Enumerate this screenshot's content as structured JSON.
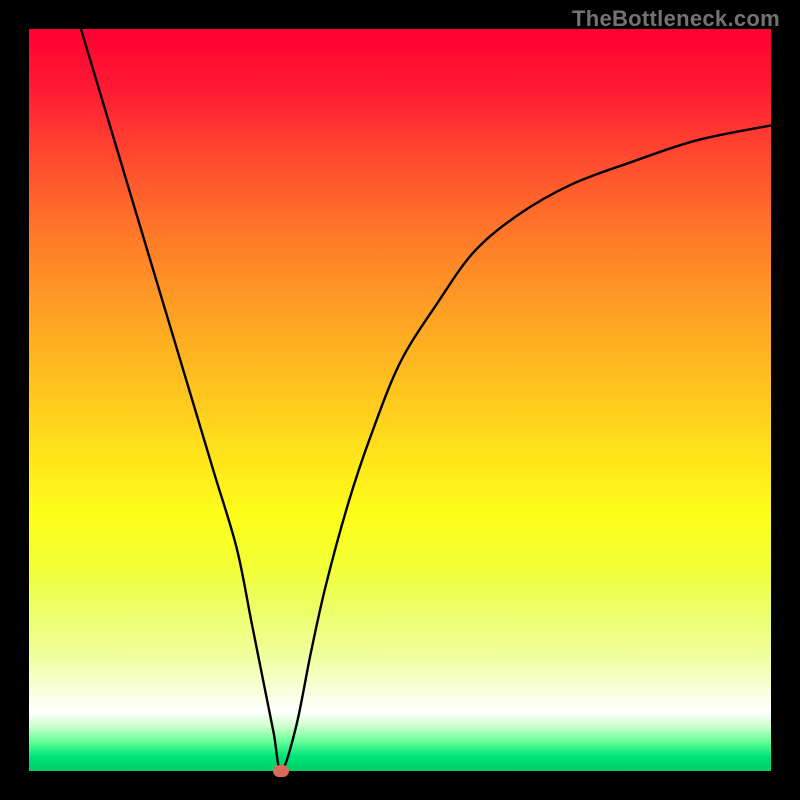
{
  "watermark": "TheBottleneck.com",
  "chart_data": {
    "type": "line",
    "title": "",
    "xlabel": "",
    "ylabel": "",
    "xlim": [
      0,
      100
    ],
    "ylim": [
      0,
      100
    ],
    "x": [
      7,
      10,
      13,
      16,
      19,
      22,
      25,
      28,
      30,
      32,
      33,
      34,
      36,
      38,
      40,
      43,
      46,
      50,
      55,
      60,
      66,
      73,
      81,
      90,
      100
    ],
    "values": [
      100,
      90,
      80,
      70,
      60,
      50,
      40,
      30,
      20,
      10,
      5,
      0,
      6,
      16,
      25,
      36,
      45,
      55,
      63,
      70,
      75,
      79,
      82,
      85,
      87
    ],
    "minimum_point": {
      "x": 34,
      "y": 0
    }
  },
  "colors": {
    "curve": "#000000",
    "marker": "#d96a5a",
    "background_frame": "#000000"
  }
}
